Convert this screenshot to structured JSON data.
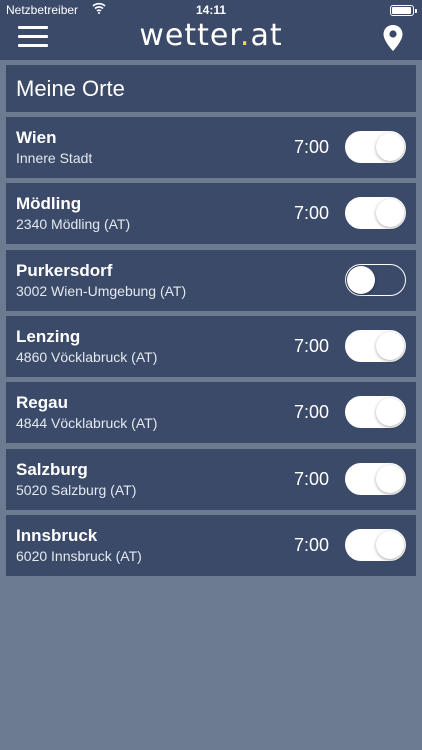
{
  "status_bar": {
    "carrier": "Netzbetreiber",
    "time": "14:11"
  },
  "header": {
    "logo_main": "wetter",
    "logo_dot": ".",
    "logo_tld": "at",
    "icons": {
      "menu": "hamburger-menu-icon",
      "location": "location-pin-icon"
    }
  },
  "section": {
    "title": "Meine Orte"
  },
  "locations": [
    {
      "name": "Wien",
      "subtitle": "Innere Stadt",
      "time": "7:00",
      "enabled": true
    },
    {
      "name": "Mödling",
      "subtitle": "2340 Mödling (AT)",
      "time": "7:00",
      "enabled": true
    },
    {
      "name": "Purkersdorf",
      "subtitle": "3002 Wien-Umgebung (AT)",
      "time": "",
      "enabled": false
    },
    {
      "name": "Lenzing",
      "subtitle": "4860 Vöcklabruck (AT)",
      "time": "7:00",
      "enabled": true
    },
    {
      "name": "Regau",
      "subtitle": "4844 Vöcklabruck (AT)",
      "time": "7:00",
      "enabled": true
    },
    {
      "name": "Salzburg",
      "subtitle": "5020 Salzburg (AT)",
      "time": "7:00",
      "enabled": true
    },
    {
      "name": "Innsbruck",
      "subtitle": "6020 Innsbruck (AT)",
      "time": "7:00",
      "enabled": true
    }
  ],
  "colors": {
    "header_bg": "#3b4a68",
    "page_bg": "#6d7b90",
    "accent_dot": "#e8e23a"
  }
}
